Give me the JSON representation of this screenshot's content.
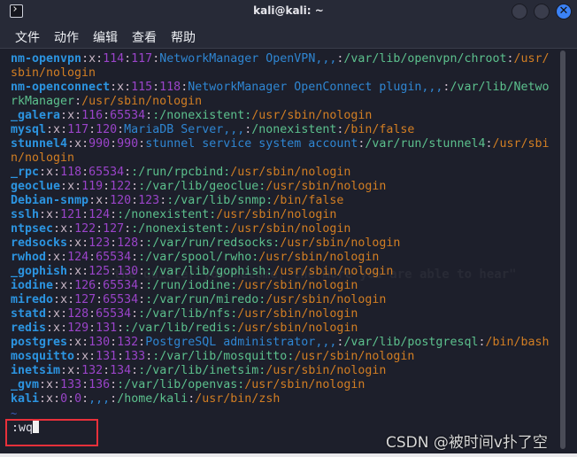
{
  "window": {
    "title": "kali@kali: ~",
    "icon": "terminal-icon",
    "controls": [
      "minimize",
      "maximize",
      "close"
    ],
    "close_glyph": "✕"
  },
  "menu": [
    "文件",
    "动作",
    "编辑",
    "查看",
    "帮助"
  ],
  "passwd_lines": [
    [
      "nm-openvpn",
      "x",
      "114",
      "117",
      "NetworkManager OpenVPN,,,",
      "/var/lib/openvpn/chroot",
      "/usr/sbin/nologin"
    ],
    [
      "nm-openconnect",
      "x",
      "115",
      "118",
      "NetworkManager OpenConnect plugin,,,",
      "/var/lib/NetworkManager",
      "/usr/sbin/nologin"
    ],
    [
      "_galera",
      "x",
      "116",
      "65534",
      "",
      "/nonexistent",
      "/usr/sbin/nologin"
    ],
    [
      "mysql",
      "x",
      "117",
      "120",
      "MariaDB Server,,,",
      "/nonexistent",
      "/bin/false"
    ],
    [
      "stunnel4",
      "x",
      "990",
      "990",
      "stunnel service system account",
      "/var/run/stunnel4",
      "/usr/sbin/nologin"
    ],
    [
      "_rpc",
      "x",
      "118",
      "65534",
      "",
      "/run/rpcbind",
      "/usr/sbin/nologin"
    ],
    [
      "geoclue",
      "x",
      "119",
      "122",
      "",
      "/var/lib/geoclue",
      "/usr/sbin/nologin"
    ],
    [
      "Debian-snmp",
      "x",
      "120",
      "123",
      "",
      "/var/lib/snmp",
      "/bin/false"
    ],
    [
      "sslh",
      "x",
      "121",
      "124",
      "",
      "/nonexistent",
      "/usr/sbin/nologin"
    ],
    [
      "ntpsec",
      "x",
      "122",
      "127",
      "",
      "/nonexistent",
      "/usr/sbin/nologin"
    ],
    [
      "redsocks",
      "x",
      "123",
      "128",
      "",
      "/var/run/redsocks",
      "/usr/sbin/nologin"
    ],
    [
      "rwhod",
      "x",
      "124",
      "65534",
      "",
      "/var/spool/rwho",
      "/usr/sbin/nologin"
    ],
    [
      "_gophish",
      "x",
      "125",
      "130",
      "",
      "/var/lib/gophish",
      "/usr/sbin/nologin"
    ],
    [
      "iodine",
      "x",
      "126",
      "65534",
      "",
      "/run/iodine",
      "/usr/sbin/nologin"
    ],
    [
      "miredo",
      "x",
      "127",
      "65534",
      "",
      "/var/run/miredo",
      "/usr/sbin/nologin"
    ],
    [
      "statd",
      "x",
      "128",
      "65534",
      "",
      "/var/lib/nfs",
      "/usr/sbin/nologin"
    ],
    [
      "redis",
      "x",
      "129",
      "131",
      "",
      "/var/lib/redis",
      "/usr/sbin/nologin"
    ],
    [
      "postgres",
      "x",
      "130",
      "132",
      "PostgreSQL administrator,,,",
      "/var/lib/postgresql",
      "/bin/bash"
    ],
    [
      "mosquitto",
      "x",
      "131",
      "133",
      "",
      "/var/lib/mosquitto",
      "/usr/sbin/nologin"
    ],
    [
      "inetsim",
      "x",
      "132",
      "134",
      "",
      "/var/lib/inetsim",
      "/usr/sbin/nologin"
    ],
    [
      "_gvm",
      "x",
      "133",
      "136",
      "",
      "/var/lib/openvas",
      "/usr/sbin/nologin"
    ],
    [
      "kali",
      "x",
      "0",
      "0",
      ",,,",
      "/home/kali",
      "/usr/bin/zsh"
    ]
  ],
  "tilde": "~",
  "command": ":wq",
  "background_watermark": "\"the quieter you become, the more you are able to hear\"",
  "csdn_watermark": "CSDN @被时间v扑了空",
  "colors": {
    "username": "#2c94e0",
    "number": "#9a44c9",
    "gecos": "#2f86d2",
    "home": "#5cc08d",
    "shell": "#d27e23",
    "highlight_box": "#e8303a"
  }
}
